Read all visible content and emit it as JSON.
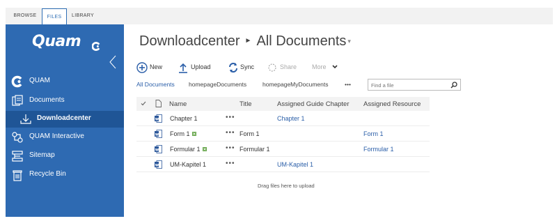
{
  "ribbon": {
    "tabs": [
      {
        "label": "BROWSE",
        "active": false
      },
      {
        "label": "FILES",
        "active": true
      },
      {
        "label": "LIBRARY",
        "active": false
      }
    ]
  },
  "nav": {
    "logo": "Quam",
    "items": [
      {
        "label": "QUAM",
        "icon": "quam-logo-icon"
      },
      {
        "label": "Documents",
        "icon": "documents-icon"
      },
      {
        "label": "Downloadcenter",
        "icon": "download-icon",
        "selected": true
      },
      {
        "label": "QUAM Interactive",
        "icon": "interactive-icon"
      },
      {
        "label": "Sitemap",
        "icon": "sitemap-icon"
      },
      {
        "label": "Recycle Bin",
        "icon": "recycle-bin-icon"
      }
    ]
  },
  "header": {
    "site": "Downloadcenter",
    "page": "All Documents"
  },
  "toolbar": {
    "new": "New",
    "upload": "Upload",
    "sync": "Sync",
    "share": "Share",
    "more": "More"
  },
  "views": {
    "all": "All Documents",
    "home": "homepageDocuments",
    "mine": "homepageMyDocuments",
    "ellipsis": "•••"
  },
  "search": {
    "placeholder": "Find a file"
  },
  "table": {
    "columns": [
      "Name",
      "Title",
      "Assigned Guide Chapter",
      "Assigned Resource"
    ],
    "rows": [
      {
        "name": "Chapter 1",
        "new": false,
        "title": "",
        "chapter": "Chapter 1",
        "resource": ""
      },
      {
        "name": "Form 1",
        "new": true,
        "title": "Form 1",
        "chapter": "",
        "resource": "Form 1"
      },
      {
        "name": "Formular 1",
        "new": true,
        "title": "Formular 1",
        "chapter": "",
        "resource": "Formular 1"
      },
      {
        "name": "UM-Kapitel 1",
        "new": false,
        "title": "",
        "chapter": "UM-Kapitel 1",
        "resource": ""
      }
    ],
    "row_menu": "•••"
  },
  "drag_hint": "Drag files here to upload",
  "colors": {
    "nav_bg": "#2e6ab2",
    "nav_selected": "#1f5596",
    "link": "#2a5ea8",
    "word_icon": "#2b579a",
    "new_badge": "#6aa84f"
  }
}
